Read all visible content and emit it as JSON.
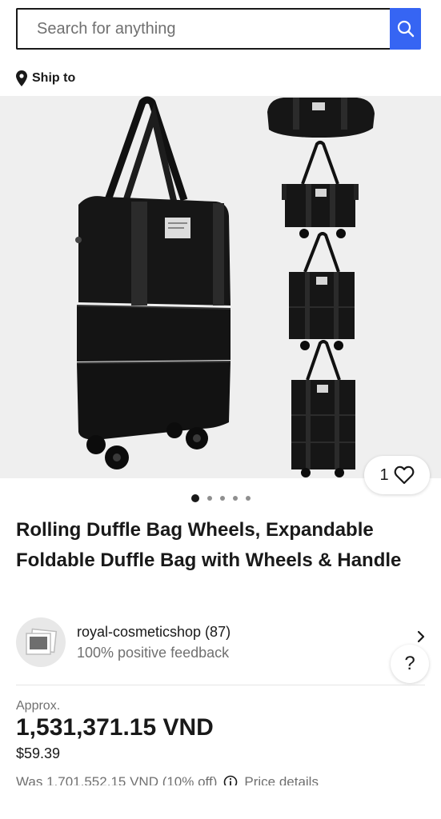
{
  "search": {
    "placeholder": "Search for anything",
    "icon": "search-icon"
  },
  "ship_to": {
    "label": "Ship to",
    "icon": "location-pin-icon"
  },
  "gallery": {
    "background": "#efefef",
    "watch_count": "1",
    "dot_count": 5,
    "active_dot": 0
  },
  "product": {
    "title": "Rolling Duffle Bag Wheels, Expandable Foldable Duffle Bag with Wheels & Handle"
  },
  "seller": {
    "name": "royal-cosmeticshop (87)",
    "feedback": "100% positive feedback"
  },
  "help": {
    "label": "?"
  },
  "pricing": {
    "approx_label": "Approx.",
    "price": "1,531,371.15 VND",
    "price_usd": "$59.39",
    "was_text": "Was 1,701,552.15 VND (10% off)",
    "details_label": "Price details"
  },
  "colors": {
    "accent": "#3665f3",
    "text": "#191919",
    "muted": "#707070"
  }
}
